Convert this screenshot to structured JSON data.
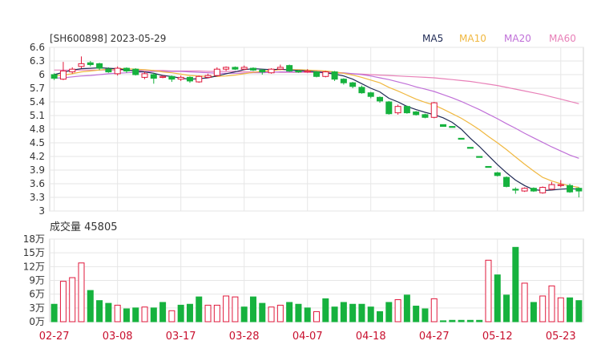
{
  "header": {
    "stock_date": "[SH600898] 2023-05-29",
    "ma_legend": [
      {
        "label": "MA5",
        "color": "#1f2a55"
      },
      {
        "label": "MA10",
        "color": "#f0b840"
      },
      {
        "label": "MA20",
        "color": "#c070d8"
      },
      {
        "label": "MA60",
        "color": "#e880b8"
      }
    ]
  },
  "volume_title": "成交量 45805",
  "colors": {
    "up": "#e0193c",
    "down": "#16b23e",
    "grid": "#d0d0d0"
  },
  "chart_data": [
    {
      "type": "candlestick",
      "ylim": [
        3,
        6.6
      ],
      "y_ticks": [
        "6.6",
        "6.3",
        "6",
        "5.7",
        "5.4",
        "5.1",
        "4.8",
        "4.5",
        "4.2",
        "3.9",
        "3.6",
        "3.3",
        "3"
      ],
      "x_ticks": [
        {
          "index": 0,
          "label": "02-27"
        },
        {
          "index": 7,
          "label": "03-08"
        },
        {
          "index": 14,
          "label": "03-17"
        },
        {
          "index": 21,
          "label": "03-28"
        },
        {
          "index": 28,
          "label": "04-07"
        },
        {
          "index": 35,
          "label": "04-18"
        },
        {
          "index": 42,
          "label": "04-27"
        },
        {
          "index": 49,
          "label": "05-12"
        },
        {
          "index": 56,
          "label": "05-23"
        }
      ],
      "candles": [
        {
          "o": 6.0,
          "c": 5.92,
          "h": 6.03,
          "l": 5.88
        },
        {
          "o": 5.9,
          "c": 6.08,
          "h": 6.28,
          "l": 5.88
        },
        {
          "o": 6.06,
          "c": 6.12,
          "h": 6.16,
          "l": 6.02
        },
        {
          "o": 6.18,
          "c": 6.24,
          "h": 6.4,
          "l": 6.14
        },
        {
          "o": 6.26,
          "c": 6.22,
          "h": 6.3,
          "l": 6.18
        },
        {
          "o": 6.24,
          "c": 6.14,
          "h": 6.26,
          "l": 6.1
        },
        {
          "o": 6.12,
          "c": 6.06,
          "h": 6.16,
          "l": 6.04
        },
        {
          "o": 6.02,
          "c": 6.14,
          "h": 6.18,
          "l": 5.98
        },
        {
          "o": 6.14,
          "c": 6.08,
          "h": 6.16,
          "l": 6.04
        },
        {
          "o": 6.12,
          "c": 6.0,
          "h": 6.14,
          "l": 5.98
        },
        {
          "o": 5.94,
          "c": 6.02,
          "h": 6.06,
          "l": 5.9
        },
        {
          "o": 6.0,
          "c": 5.92,
          "h": 6.04,
          "l": 5.8
        },
        {
          "o": 5.94,
          "c": 5.96,
          "h": 5.98,
          "l": 5.92
        },
        {
          "o": 5.96,
          "c": 5.9,
          "h": 5.98,
          "l": 5.84
        },
        {
          "o": 5.9,
          "c": 5.94,
          "h": 5.98,
          "l": 5.86
        },
        {
          "o": 5.94,
          "c": 5.86,
          "h": 5.96,
          "l": 5.82
        },
        {
          "o": 5.84,
          "c": 5.96,
          "h": 5.98,
          "l": 5.82
        },
        {
          "o": 5.94,
          "c": 5.98,
          "h": 6.02,
          "l": 5.92
        },
        {
          "o": 5.98,
          "c": 6.12,
          "h": 6.16,
          "l": 5.96
        },
        {
          "o": 6.12,
          "c": 6.16,
          "h": 6.18,
          "l": 6.08
        },
        {
          "o": 6.16,
          "c": 6.12,
          "h": 6.18,
          "l": 6.1
        },
        {
          "o": 6.12,
          "c": 6.16,
          "h": 6.2,
          "l": 6.1
        },
        {
          "o": 6.14,
          "c": 6.1,
          "h": 6.16,
          "l": 6.08
        },
        {
          "o": 6.1,
          "c": 6.06,
          "h": 6.12,
          "l": 6.0
        },
        {
          "o": 6.04,
          "c": 6.12,
          "h": 6.14,
          "l": 6.02
        },
        {
          "o": 6.12,
          "c": 6.16,
          "h": 6.22,
          "l": 6.1
        },
        {
          "o": 6.2,
          "c": 6.08,
          "h": 6.22,
          "l": 6.06
        },
        {
          "o": 6.08,
          "c": 6.06,
          "h": 6.1,
          "l": 6.04
        },
        {
          "o": 6.06,
          "c": 6.08,
          "h": 6.12,
          "l": 6.04
        },
        {
          "o": 6.06,
          "c": 5.96,
          "h": 6.08,
          "l": 5.94
        },
        {
          "o": 5.96,
          "c": 6.06,
          "h": 6.08,
          "l": 5.94
        },
        {
          "o": 6.06,
          "c": 5.9,
          "h": 6.08,
          "l": 5.86
        },
        {
          "o": 5.9,
          "c": 5.82,
          "h": 5.92,
          "l": 5.78
        },
        {
          "o": 5.82,
          "c": 5.74,
          "h": 5.84,
          "l": 5.7
        },
        {
          "o": 5.72,
          "c": 5.6,
          "h": 5.76,
          "l": 5.58
        },
        {
          "o": 5.6,
          "c": 5.52,
          "h": 5.62,
          "l": 5.48
        },
        {
          "o": 5.5,
          "c": 5.42,
          "h": 5.52,
          "l": 5.38
        },
        {
          "o": 5.4,
          "c": 5.14,
          "h": 5.42,
          "l": 5.12
        },
        {
          "o": 5.16,
          "c": 5.3,
          "h": 5.34,
          "l": 5.12
        },
        {
          "o": 5.3,
          "c": 5.16,
          "h": 5.32,
          "l": 5.14
        },
        {
          "o": 5.18,
          "c": 5.12,
          "h": 5.2,
          "l": 5.1
        },
        {
          "o": 5.12,
          "c": 5.06,
          "h": 5.14,
          "l": 5.04
        },
        {
          "o": 5.06,
          "c": 5.38,
          "h": 5.4,
          "l": 5.04
        },
        {
          "o": 4.9,
          "c": 4.86,
          "h": 4.9,
          "l": 4.86
        },
        {
          "o": 4.86,
          "c": 4.84,
          "h": 4.86,
          "l": 4.84
        },
        {
          "o": 4.6,
          "c": 4.58,
          "h": 4.6,
          "l": 4.58
        },
        {
          "o": 4.4,
          "c": 4.38,
          "h": 4.4,
          "l": 4.38
        },
        {
          "o": 4.2,
          "c": 4.18,
          "h": 4.2,
          "l": 4.18
        },
        {
          "o": 3.98,
          "c": 3.96,
          "h": 3.98,
          "l": 3.96
        },
        {
          "o": 3.84,
          "c": 3.78,
          "h": 3.86,
          "l": 3.76
        },
        {
          "o": 3.74,
          "c": 3.54,
          "h": 3.76,
          "l": 3.52
        },
        {
          "o": 3.48,
          "c": 3.46,
          "h": 3.52,
          "l": 3.38
        },
        {
          "o": 3.44,
          "c": 3.5,
          "h": 3.52,
          "l": 3.42
        },
        {
          "o": 3.5,
          "c": 3.44,
          "h": 3.52,
          "l": 3.42
        },
        {
          "o": 3.4,
          "c": 3.52,
          "h": 3.54,
          "l": 3.38
        },
        {
          "o": 3.48,
          "c": 3.58,
          "h": 3.64,
          "l": 3.46
        },
        {
          "o": 3.56,
          "c": 3.58,
          "h": 3.68,
          "l": 3.52
        },
        {
          "o": 3.56,
          "c": 3.42,
          "h": 3.6,
          "l": 3.4
        },
        {
          "o": 3.5,
          "c": 3.44,
          "h": 3.52,
          "l": 3.3
        }
      ],
      "ma5": [
        6.0,
        6.05,
        6.1,
        6.13,
        6.14,
        6.15,
        6.14,
        6.13,
        6.1,
        6.08,
        6.06,
        6.03,
        5.98,
        5.96,
        5.92,
        5.9,
        5.91,
        5.93,
        5.97,
        6.02,
        6.06,
        6.11,
        6.13,
        6.12,
        6.11,
        6.12,
        6.1,
        6.09,
        6.08,
        6.06,
        6.04,
        6.01,
        5.97,
        5.9,
        5.8,
        5.7,
        5.62,
        5.48,
        5.4,
        5.3,
        5.23,
        5.17,
        5.12,
        5.05,
        4.95,
        4.8,
        4.6,
        4.42,
        4.22,
        4.02,
        3.84,
        3.68,
        3.56,
        3.47,
        3.45,
        3.46,
        3.48,
        3.49,
        3.48
      ],
      "ma10": [
        5.98,
        5.99,
        6.02,
        6.06,
        6.08,
        6.1,
        6.12,
        6.13,
        6.13,
        6.12,
        6.11,
        6.09,
        6.06,
        6.04,
        6.01,
        5.98,
        5.97,
        5.96,
        5.96,
        5.97,
        5.99,
        6.02,
        6.05,
        6.07,
        6.09,
        6.11,
        6.11,
        6.11,
        6.1,
        6.09,
        6.08,
        6.06,
        6.03,
        5.99,
        5.94,
        5.88,
        5.82,
        5.72,
        5.64,
        5.55,
        5.46,
        5.39,
        5.33,
        5.24,
        5.14,
        5.04,
        4.92,
        4.79,
        4.64,
        4.5,
        4.35,
        4.19,
        4.03,
        3.88,
        3.74,
        3.66,
        3.6,
        3.55,
        3.52
      ],
      "ma20": [
        5.92,
        5.93,
        5.95,
        5.97,
        5.98,
        6.0,
        6.02,
        6.03,
        6.04,
        6.05,
        6.06,
        6.07,
        6.07,
        6.07,
        6.07,
        6.06,
        6.05,
        6.04,
        6.03,
        6.03,
        6.03,
        6.03,
        6.04,
        6.04,
        6.05,
        6.06,
        6.06,
        6.06,
        6.07,
        6.07,
        6.06,
        6.05,
        6.04,
        6.02,
        6.0,
        5.97,
        5.93,
        5.89,
        5.84,
        5.79,
        5.73,
        5.68,
        5.63,
        5.56,
        5.49,
        5.41,
        5.32,
        5.23,
        5.13,
        5.03,
        4.92,
        4.82,
        4.71,
        4.61,
        4.51,
        4.41,
        4.32,
        4.23,
        4.16
      ],
      "ma60": [
        6.1,
        6.1,
        6.1,
        6.1,
        6.1,
        6.1,
        6.1,
        6.1,
        6.1,
        6.09,
        6.09,
        6.09,
        6.09,
        6.08,
        6.08,
        6.08,
        6.08,
        6.07,
        6.07,
        6.07,
        6.07,
        6.06,
        6.06,
        6.06,
        6.06,
        6.05,
        6.05,
        6.05,
        6.05,
        6.04,
        6.04,
        6.03,
        6.03,
        6.02,
        6.01,
        6.0,
        5.99,
        5.98,
        5.97,
        5.96,
        5.95,
        5.94,
        5.93,
        5.91,
        5.89,
        5.87,
        5.85,
        5.82,
        5.79,
        5.76,
        5.72,
        5.68,
        5.64,
        5.6,
        5.56,
        5.51,
        5.46,
        5.41,
        5.36
      ]
    },
    {
      "type": "bar",
      "title": "成交量 45805",
      "ylim": [
        0,
        18
      ],
      "y_ticks": [
        "18万",
        "15万",
        "12万",
        "9万",
        "6万",
        "3万",
        "0万"
      ],
      "values": [
        3.8,
        8.8,
        9.6,
        12.8,
        6.8,
        4.6,
        4.0,
        3.6,
        2.8,
        3.0,
        3.2,
        3.0,
        4.2,
        2.4,
        3.6,
        3.8,
        5.4,
        3.6,
        3.6,
        5.6,
        5.4,
        3.2,
        5.4,
        4.0,
        3.2,
        3.6,
        4.2,
        3.8,
        3.0,
        2.2,
        5.0,
        3.2,
        4.2,
        3.8,
        3.8,
        3.2,
        2.2,
        4.2,
        4.8,
        5.8,
        3.4,
        2.8,
        5.0,
        0.2,
        0.3,
        0.3,
        0.3,
        0.3,
        13.4,
        10.2,
        5.8,
        16.2,
        8.4,
        4.2,
        5.6,
        7.8,
        5.2,
        5.2,
        4.6
      ],
      "directions": [
        "down",
        "up",
        "up",
        "up",
        "down",
        "down",
        "down",
        "up",
        "down",
        "down",
        "up",
        "down",
        "down",
        "up",
        "down",
        "down",
        "down",
        "up",
        "up",
        "up",
        "up",
        "down",
        "down",
        "down",
        "up",
        "up",
        "down",
        "down",
        "down",
        "up",
        "down",
        "down",
        "down",
        "down",
        "down",
        "down",
        "down",
        "down",
        "up",
        "down",
        "down",
        "down",
        "up",
        "down",
        "down",
        "down",
        "down",
        "down",
        "up",
        "down",
        "down",
        "down",
        "up",
        "down",
        "up",
        "up",
        "up",
        "down",
        "down"
      ]
    }
  ]
}
